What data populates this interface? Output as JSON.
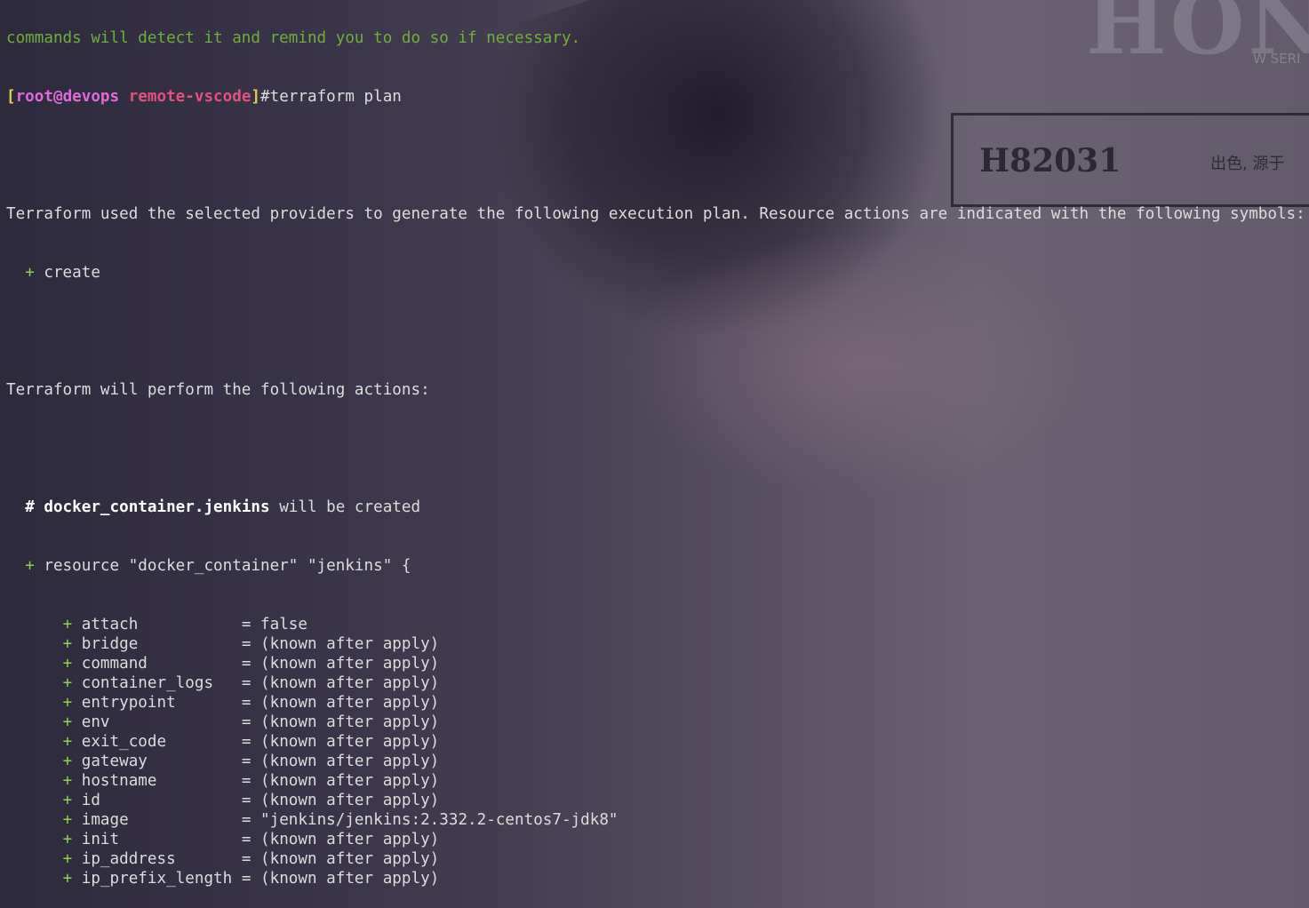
{
  "terminal": {
    "prev_line": "commands will detect it and remind you to do so if necessary.",
    "prompt": {
      "open_bracket": "[",
      "user": "root",
      "at": "@",
      "host": "devops",
      "dir": "remote-vscode",
      "close_bracket": "]",
      "command": "#terraform plan"
    },
    "intro_line": "Terraform used the selected providers to generate the following execution plan. Resource actions are indicated with the following symbols:",
    "symbol_plus": "+",
    "symbol_label": "create",
    "actions_line": "Terraform will perform the following actions:",
    "resource_hash": "#",
    "resource_name": "docker_container.jenkins",
    "resource_suffix": "will be created",
    "resource_decl": "resource \"docker_container\" \"jenkins\" {",
    "attributes": [
      {
        "name": "attach           ",
        "value": "= false"
      },
      {
        "name": "bridge           ",
        "value": "= (known after apply)"
      },
      {
        "name": "command          ",
        "value": "= (known after apply)"
      },
      {
        "name": "container_logs   ",
        "value": "= (known after apply)"
      },
      {
        "name": "entrypoint       ",
        "value": "= (known after apply)"
      },
      {
        "name": "env              ",
        "value": "= (known after apply)"
      },
      {
        "name": "exit_code        ",
        "value": "= (known after apply)"
      },
      {
        "name": "gateway          ",
        "value": "= (known after apply)"
      },
      {
        "name": "hostname         ",
        "value": "= (known after apply)"
      },
      {
        "name": "id               ",
        "value": "= (known after apply)"
      },
      {
        "name": "image            ",
        "value": "= \"jenkins/jenkins:2.332.2-centos7-jdk8\""
      },
      {
        "name": "init             ",
        "value": "= (known after apply)"
      },
      {
        "name": "ip_address       ",
        "value": "= (known after apply)"
      },
      {
        "name": "ip_prefix_length ",
        "value": "= (known after apply)"
      }
    ]
  },
  "background": {
    "poster_letters": "HON",
    "poster_sub": "W SERI",
    "poster_code": "H82031",
    "poster_cn": "出色, 源于"
  }
}
